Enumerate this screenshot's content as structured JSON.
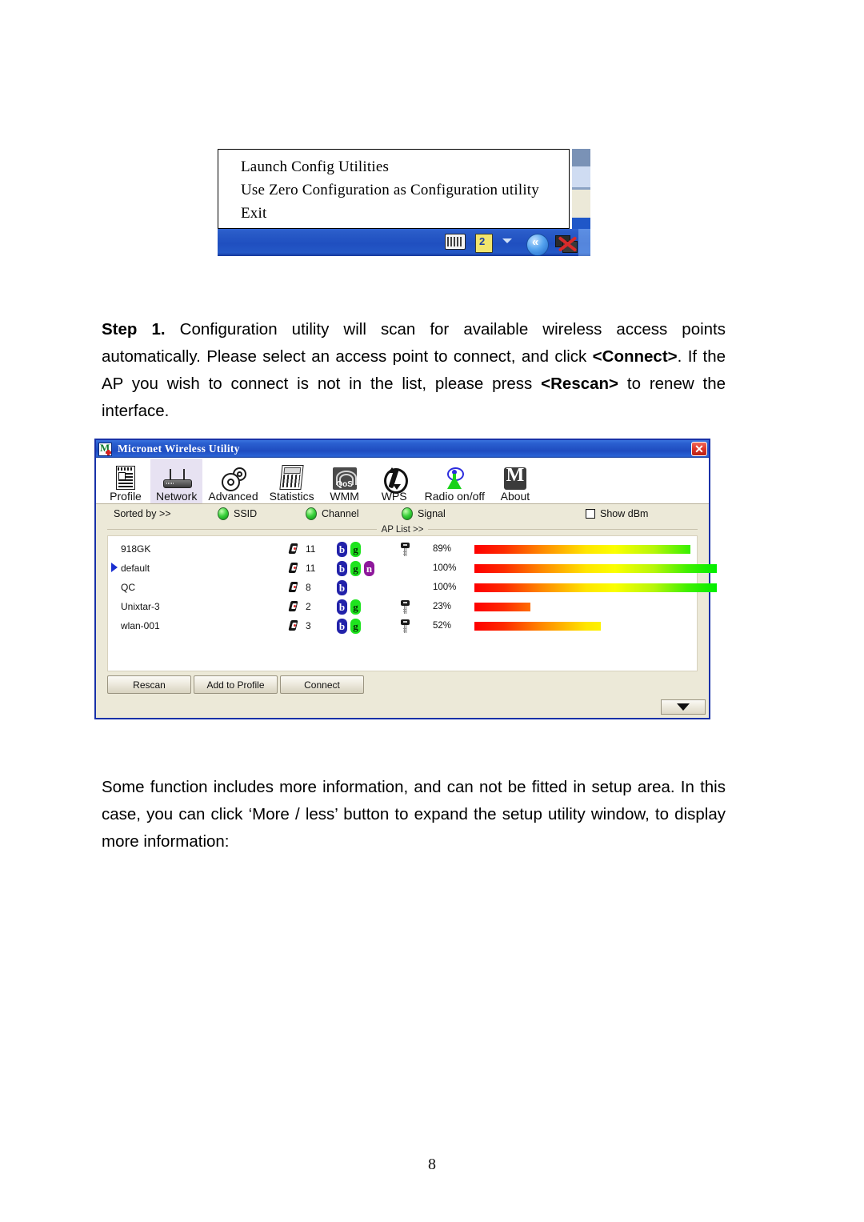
{
  "document": {
    "page_number": "8",
    "step_paragraph_prefix": "Step 1.",
    "step_paragraph": " Configuration utility will scan for available wireless access points automatically. Please select an access point to connect, and click ",
    "step_bold_1": "<Connect>",
    "step_paragraph_2": ". If the AP you wish to connect is not in the list, please press ",
    "step_bold_2": "<Rescan>",
    "step_paragraph_3": " to renew the interface.",
    "tail_paragraph": "Some function includes more information, and can not be fitted in setup area. In this case, you can click ‘More / less’ button to expand the setup utility window, to display more information:"
  },
  "tray_menu": {
    "items": [
      {
        "label": "Launch Config Utilities"
      },
      {
        "label": "Use Zero Configuration as Configuration utility"
      },
      {
        "label": "Exit"
      }
    ],
    "tray_icons": [
      "keyboard-icon",
      "sticky-note-icon",
      "show-hidden-icons-chevron",
      "blue-arrow-icon",
      "network-disconnected-icon"
    ]
  },
  "utility_window": {
    "title": "Micronet Wireless Utility",
    "close_label": "✕",
    "toolbar": [
      {
        "label": "Profile",
        "icon": "profile-icon",
        "active": false
      },
      {
        "label": "Network",
        "icon": "router-icon",
        "active": true
      },
      {
        "label": "Advanced",
        "icon": "gears-icon",
        "active": false
      },
      {
        "label": "Statistics",
        "icon": "calculator-icon",
        "active": false
      },
      {
        "label": "WMM",
        "icon": "qos-icon",
        "active": false
      },
      {
        "label": "WPS",
        "icon": "wps-icon",
        "active": false
      },
      {
        "label": "Radio on/off",
        "icon": "antenna-icon",
        "active": false
      },
      {
        "label": "About",
        "icon": "about-m-icon",
        "active": false
      }
    ],
    "sortbar": {
      "sorted_by_label": "Sorted by >>",
      "options": [
        {
          "label": "SSID"
        },
        {
          "label": "Channel"
        },
        {
          "label": "Signal"
        }
      ],
      "show_dbm_label": "Show dBm",
      "show_dbm_checked": false
    },
    "ap_list_divider": "AP List >>",
    "ap_list": {
      "selected_index": 1,
      "rows": [
        {
          "ssid": "918GK",
          "channel": "11",
          "modes": [
            "b",
            "g"
          ],
          "secured": true,
          "signal": "89%",
          "signal_value": 89
        },
        {
          "ssid": "default",
          "channel": "11",
          "modes": [
            "b",
            "g",
            "n"
          ],
          "secured": false,
          "signal": "100%",
          "signal_value": 100
        },
        {
          "ssid": "QC",
          "channel": "8",
          "modes": [
            "b"
          ],
          "secured": false,
          "signal": "100%",
          "signal_value": 100
        },
        {
          "ssid": "Unixtar-3",
          "channel": "2",
          "modes": [
            "b",
            "g"
          ],
          "secured": true,
          "signal": "23%",
          "signal_value": 23
        },
        {
          "ssid": "wlan-001",
          "channel": "3",
          "modes": [
            "b",
            "g"
          ],
          "secured": true,
          "signal": "52%",
          "signal_value": 52
        }
      ]
    },
    "buttons": [
      {
        "label": "Rescan"
      },
      {
        "label": "Add to Profile"
      },
      {
        "label": "Connect"
      }
    ],
    "more_less_button": "more-less-expand-arrow"
  },
  "colors": {
    "titlebar_blue": "#1f4cc0",
    "window_face": "#ece9d8",
    "active_tab": "#e7e2f2",
    "badge_b": "#2222aa",
    "badge_g": "#1ee41e",
    "badge_n": "#8e189b",
    "selection_arrow": "#1a2fd0",
    "signal_gradient": "#fe0000 → #ffe500 → #00ee00"
  }
}
